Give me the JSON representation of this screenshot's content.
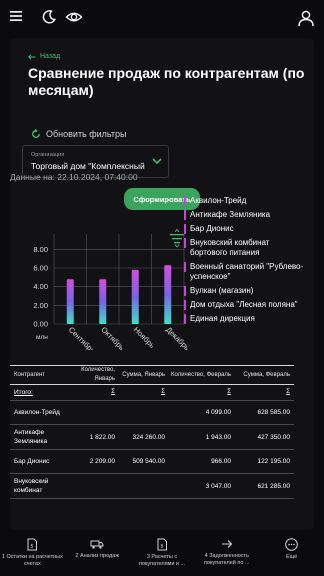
{
  "header": {
    "icons": [
      "menu-icon",
      "moon-icon",
      "eye-icon",
      "user-icon"
    ]
  },
  "page": {
    "back_label": "Назад",
    "title": "Сравнение продаж по контрагентам (по месяцам)",
    "refresh_label": "Обновить фильтры",
    "org_label": "Организация",
    "org_value": "Торговый дом \"Комплексный",
    "form_button": "Сформировать",
    "data_on": "Данные на: 22.10.2024, 07:40:00"
  },
  "chart_data": {
    "type": "bar",
    "categories": [
      "Сентябрь",
      "Октябрь",
      "Ноябрь",
      "Декабрь"
    ],
    "ytick_labels": [
      "8.00",
      "6.00",
      "4.00",
      "2.00",
      "0.00"
    ],
    "yunit": "млн",
    "ylim": [
      0,
      9
    ],
    "values": [
      4.8,
      4.8,
      5.8,
      6.3
    ],
    "colors": {
      "top": "#d24ee0",
      "mid": "#7a63e6",
      "bottom": "#3fe0c8"
    },
    "legend": [
      "Аквилон-Трейд",
      "Антикафе Земляника",
      "Бар Дионис",
      "Внуковский комбинат бортового питания",
      "Военный санаторий \"Рублево-успенское\"",
      "Вулкан (магазин)",
      "Дом отдыха \"Лесная поляна\"",
      "Единая дирекция"
    ]
  },
  "table": {
    "headers": [
      "Контрагент",
      "Количество, Январь",
      "Сумма, Январь",
      "Количество, Февраль",
      "Сумма, Февраль"
    ],
    "total_label": "Итого:",
    "sigma": "Σ",
    "rows": [
      [
        "Аквилон-Трейд",
        "",
        "",
        "4 099.00",
        "628 585.00"
      ],
      [
        "Антикафе Земляника",
        "1 822.00",
        "324 260.00",
        "1 943.00",
        "427 350.00"
      ],
      [
        "Бар Дионис",
        "2 209.00",
        "509 540.00",
        "966.00",
        "122 195.00"
      ],
      [
        "Внуковский комбинат",
        "",
        "",
        "3 047.00",
        "621 285.00"
      ]
    ]
  },
  "bottom_nav": [
    {
      "label": "1 Остатки на расчетных счетах",
      "icon": "document-icon"
    },
    {
      "label": "2 Анализ продаж",
      "icon": "truck-icon"
    },
    {
      "label": "3 Расчеты с покупателями и ...",
      "icon": "document-icon"
    },
    {
      "label": "4 Задолженность покупателей по ...",
      "icon": "arrow-right-icon"
    },
    {
      "label": "Ещё",
      "icon": "more-icon"
    }
  ]
}
